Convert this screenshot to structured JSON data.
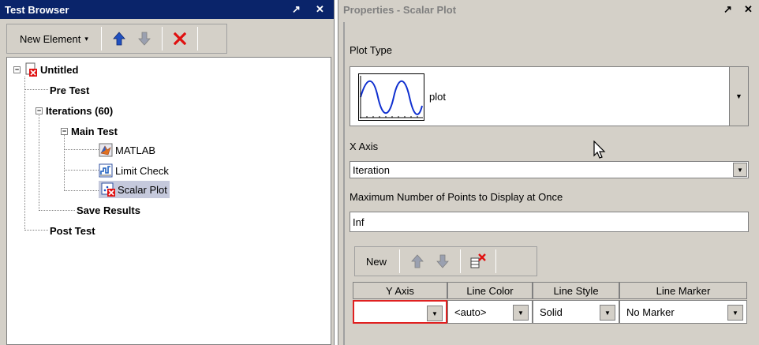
{
  "test_browser": {
    "title": "Test Browser",
    "pin_glyph": "↗",
    "close_glyph": "✕",
    "toolbar": {
      "new_element_label": "New Element",
      "caret": "▾"
    },
    "tree": [
      {
        "label": "Untitled",
        "bold": true,
        "icon": "untitled-doc-icon",
        "expander": "−"
      },
      {
        "label": "Pre Test",
        "bold": true
      },
      {
        "label": "Iterations  (60)",
        "bold": true,
        "expander": "−"
      },
      {
        "label": "Main Test",
        "bold": true,
        "expander": "−"
      },
      {
        "label": "MATLAB",
        "bold": false,
        "icon": "matlab-icon"
      },
      {
        "label": "Limit Check",
        "bold": false,
        "icon": "limit-check-icon"
      },
      {
        "label": "Scalar Plot",
        "bold": false,
        "icon": "scalar-plot-icon",
        "selected": true
      },
      {
        "label": "Save Results",
        "bold": true
      },
      {
        "label": "Post Test",
        "bold": true
      }
    ]
  },
  "properties": {
    "title": "Properties - Scalar Plot",
    "pin_glyph": "↗",
    "close_glyph": "✕",
    "plot_type_label": "Plot Type",
    "plot_type_value": "plot",
    "x_axis_label": "X Axis",
    "x_axis_value": "Iteration",
    "max_points_label": "Maximum Number of Points to Display at Once",
    "max_points_value": "Inf",
    "toolbar": {
      "new_label": "New"
    },
    "table": {
      "columns": [
        "Y Axis",
        "Line Color",
        "Line Style",
        "Line Marker"
      ],
      "row": {
        "y_axis": "",
        "line_color": "<auto>",
        "line_style": "Solid",
        "line_marker": "No Marker"
      }
    }
  },
  "colors": {
    "active_title_bg": "#0a246a",
    "panel_bg": "#d4d0c8",
    "error_border": "#e02020",
    "up_arrow": "#2050c0",
    "delete_red": "#e01010"
  }
}
